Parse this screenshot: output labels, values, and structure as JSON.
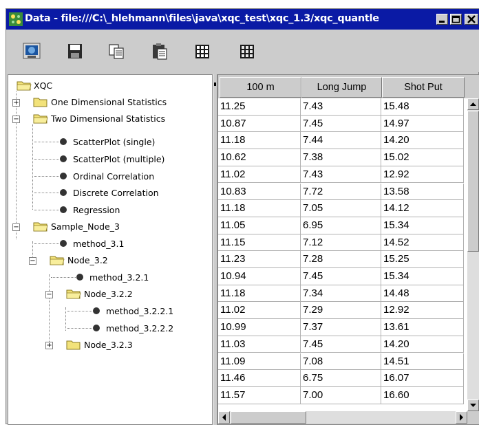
{
  "window": {
    "title": "Data - file:///C:\\_hlehmann\\files\\java\\xqc_test\\xqc_1.3/xqc_quantle"
  },
  "toolbar": {
    "buttons": [
      {
        "icon": "open-data-icon"
      },
      {
        "icon": "save-icon"
      },
      {
        "icon": "copy-icon"
      },
      {
        "icon": "paste-icon"
      },
      {
        "icon": "table-icon"
      },
      {
        "icon": "table-alt-icon"
      }
    ]
  },
  "tree": {
    "root": "XQC",
    "nodes": [
      {
        "label": "One Dimensional Statistics"
      },
      {
        "label": "Two Dimensional Statistics"
      },
      {
        "label": "ScatterPlot (single)"
      },
      {
        "label": "ScatterPlot (multiple)"
      },
      {
        "label": "Ordinal Correlation"
      },
      {
        "label": "Discrete Correlation"
      },
      {
        "label": "Regression"
      },
      {
        "label": "Sample_Node_3"
      },
      {
        "label": "method_3.1"
      },
      {
        "label": "Node_3.2"
      },
      {
        "label": "method_3.2.1"
      },
      {
        "label": "Node_3.2.2"
      },
      {
        "label": "method_3.2.2.1"
      },
      {
        "label": "method_3.2.2.2"
      },
      {
        "label": "Node_3.2.3"
      }
    ]
  },
  "table": {
    "headers": [
      "100 m",
      "Long Jump",
      "Shot Put"
    ],
    "rows": [
      [
        "11.25",
        "7.43",
        "15.48"
      ],
      [
        "10.87",
        "7.45",
        "14.97"
      ],
      [
        "11.18",
        "7.44",
        "14.20"
      ],
      [
        "10.62",
        "7.38",
        "15.02"
      ],
      [
        "11.02",
        "7.43",
        "12.92"
      ],
      [
        "10.83",
        "7.72",
        "13.58"
      ],
      [
        "11.18",
        "7.05",
        "14.12"
      ],
      [
        "11.05",
        "6.95",
        "15.34"
      ],
      [
        "11.15",
        "7.12",
        "14.52"
      ],
      [
        "11.23",
        "7.28",
        "15.25"
      ],
      [
        "10.94",
        "7.45",
        "15.34"
      ],
      [
        "11.18",
        "7.34",
        "14.48"
      ],
      [
        "11.02",
        "7.29",
        "12.92"
      ],
      [
        "10.99",
        "7.37",
        "13.61"
      ],
      [
        "11.03",
        "7.45",
        "14.20"
      ],
      [
        "11.09",
        "7.08",
        "14.51"
      ],
      [
        "11.46",
        "6.75",
        "16.07"
      ],
      [
        "11.57",
        "7.00",
        "16.60"
      ]
    ]
  },
  "colors": {
    "titlebar": "#0a1aa5",
    "folder": "#f2e27a"
  }
}
